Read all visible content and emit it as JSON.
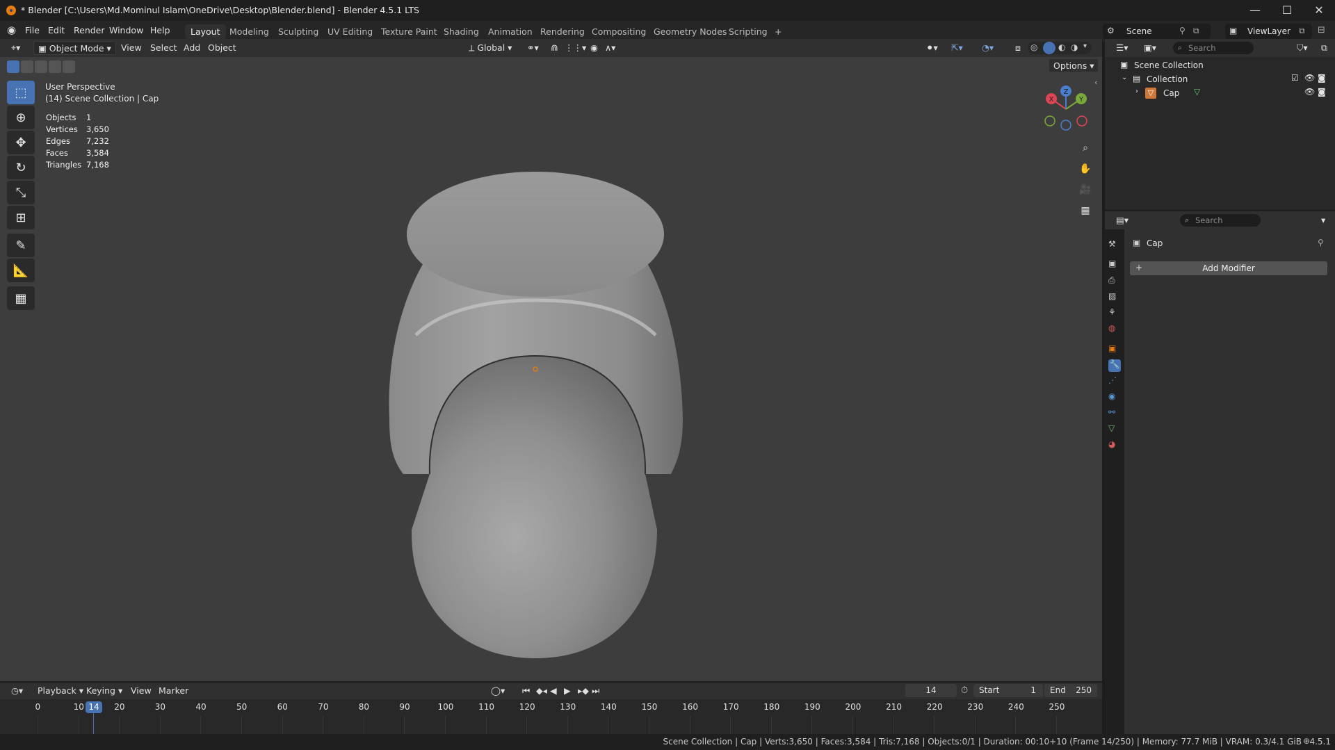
{
  "window": {
    "title": "* Blender [C:\\Users\\Md.Mominul Islam\\OneDrive\\Desktop\\Blender.blend] - Blender 4.5.1 LTS",
    "controls": {
      "minimize": "—",
      "maximize": "☐",
      "close": "✕"
    }
  },
  "menu": {
    "items": [
      "File",
      "Edit",
      "Render",
      "Window",
      "Help"
    ],
    "workspaces": [
      "Layout",
      "Modeling",
      "Sculpting",
      "UV Editing",
      "Texture Paint",
      "Shading",
      "Animation",
      "Rendering",
      "Compositing",
      "Geometry Nodes",
      "Scripting"
    ],
    "active_workspace": "Layout",
    "add_workspace": "+",
    "scene_label": "Scene",
    "view_layer_label": "ViewLayer"
  },
  "viewport_header": {
    "mode": "Object Mode",
    "menus": [
      "View",
      "Select",
      "Add",
      "Object"
    ],
    "orientation": "Global",
    "options": "Options"
  },
  "viewport": {
    "perspective": "User Perspective",
    "context": "(14) Scene Collection | Cap",
    "stats": [
      {
        "label": "Objects",
        "value": "1"
      },
      {
        "label": "Vertices",
        "value": "3,650"
      },
      {
        "label": "Edges",
        "value": "7,232"
      },
      {
        "label": "Faces",
        "value": "3,584"
      },
      {
        "label": "Triangles",
        "value": "7,168"
      }
    ],
    "gizmo": {
      "x": "X",
      "y": "Y",
      "z": "Z"
    }
  },
  "timeline": {
    "menus": [
      "Playback",
      "Keying",
      "View",
      "Marker"
    ],
    "current_frame": "14",
    "start_label": "Start",
    "start_value": "1",
    "end_label": "End",
    "end_value": "250",
    "ticks": [
      "0",
      "10",
      "20",
      "30",
      "40",
      "50",
      "60",
      "70",
      "80",
      "90",
      "100",
      "110",
      "120",
      "130",
      "140",
      "150",
      "160",
      "170",
      "180",
      "190",
      "200",
      "210",
      "220",
      "230",
      "240",
      "250"
    ]
  },
  "status": {
    "text": "Scene Collection | Cap | Verts:3,650 | Faces:3,584 | Tris:7,168 | Objects:0/1 | Duration: 00:10+10 (Frame 14/250) | Memory: 77.7 MiB | VRAM: 0.3/4.1 GiB",
    "version": "4.5.1"
  },
  "outliner": {
    "search_placeholder": "Search",
    "scene_collection": "Scene Collection",
    "collection": "Collection",
    "object": "Cap"
  },
  "properties": {
    "search_placeholder": "Search",
    "object_name": "Cap",
    "add_modifier": "Add Modifier"
  },
  "colors": {
    "accent": "#4772b3",
    "viewport_bg": "#3d3d3d",
    "object_orange": "#e87d0d"
  }
}
